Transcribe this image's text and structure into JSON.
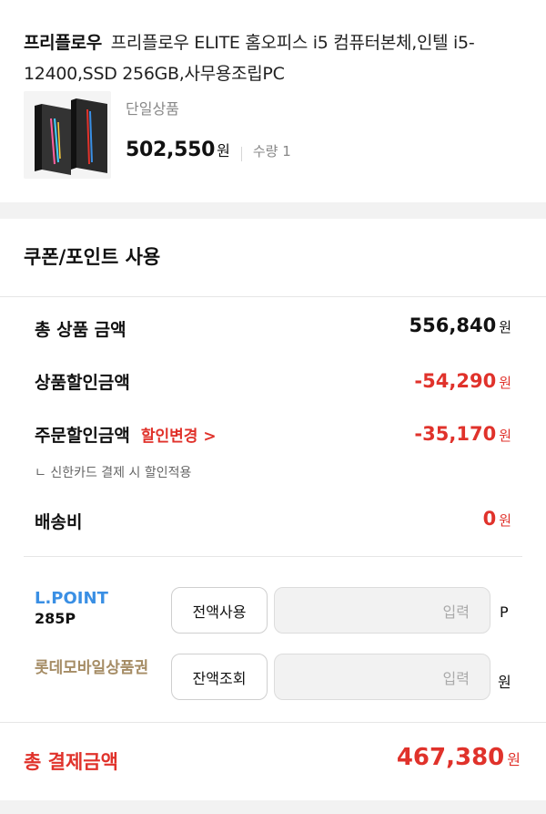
{
  "product": {
    "brand": "프리플로우",
    "title": "프리플로우 ELITE 홈오피스 i5 컴퓨터본체,인텔 i5-12400,SSD 256GB,사무용조립PC",
    "option": "단일상품",
    "price": "502,550",
    "price_unit": "원",
    "quantity": "수량 1"
  },
  "coupon_section": {
    "title": "쿠폰/포인트 사용"
  },
  "summary": {
    "total_product": {
      "label": "총 상품 금액",
      "value": "556,840",
      "unit": "원"
    },
    "product_discount": {
      "label": "상품할인금액",
      "value": "-54,290",
      "unit": "원"
    },
    "order_discount": {
      "label": "주문할인금액",
      "link": "할인변경 >",
      "value": "-35,170",
      "unit": "원"
    },
    "order_discount_note": "ㄴ 신한카드 결제 시 할인적용",
    "shipping": {
      "label": "배송비",
      "value": "0",
      "unit": "원"
    }
  },
  "lpoint": {
    "label": "L.POINT",
    "balance": "285P",
    "button": "전액사용",
    "placeholder": "입력",
    "unit": "P"
  },
  "voucher": {
    "label": "롯데모바일상품권",
    "button": "잔액조회",
    "placeholder": "입력",
    "unit": "원"
  },
  "total": {
    "label": "총 결제금액",
    "value": "467,380",
    "unit": "원"
  },
  "colors": {
    "accent_red": "#e0322b",
    "lpoint_blue": "#3a8fe4",
    "voucher_gold": "#a58c65"
  }
}
